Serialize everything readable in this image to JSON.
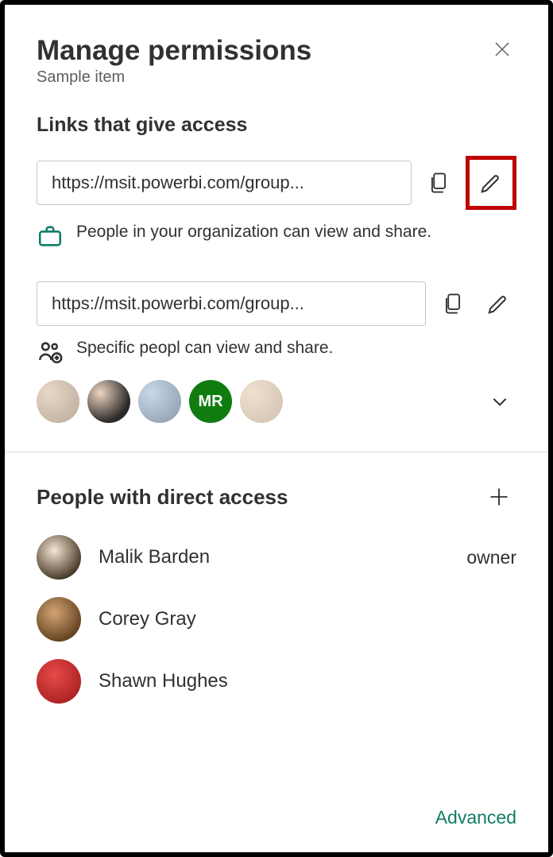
{
  "header": {
    "title": "Manage permissions",
    "subtitle": "Sample item"
  },
  "links_section": {
    "label": "Links that give access",
    "items": [
      {
        "url_display": "https://msit.powerbi.com/group...",
        "description": "People in your organization can view and share."
      },
      {
        "url_display": "https://msit.powerbi.com/group...",
        "description": "Specific peopl can view and share.",
        "avatar_badge": "MR"
      }
    ]
  },
  "direct_section": {
    "label": "People with direct access",
    "people": [
      {
        "name": "Malik Barden",
        "role": "owner"
      },
      {
        "name": "Corey Gray",
        "role": ""
      },
      {
        "name": "Shawn Hughes",
        "role": ""
      }
    ]
  },
  "footer": {
    "advanced": "Advanced"
  }
}
